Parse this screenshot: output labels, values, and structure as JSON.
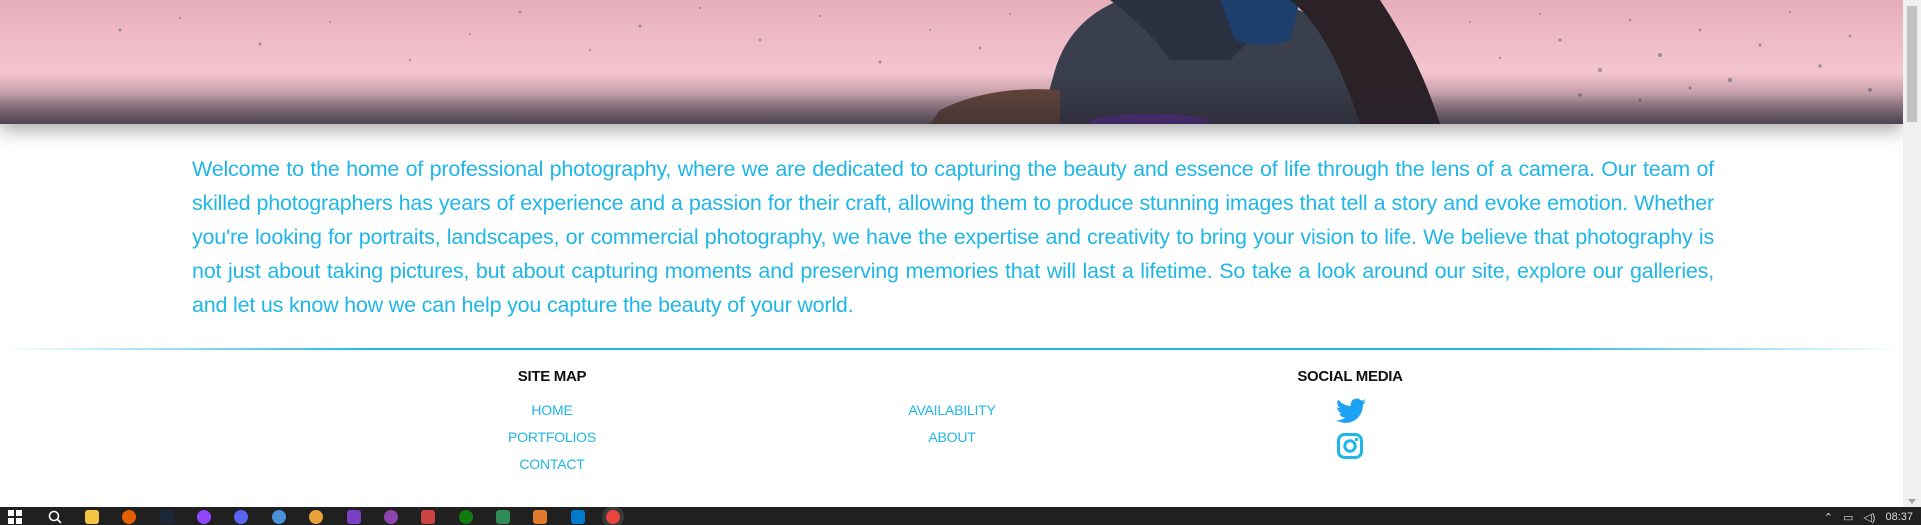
{
  "welcome_text": "Welcome to the home of professional photography, where we are dedicated to capturing the beauty and essence of life through the lens of a camera. Our team of skilled photographers has years of experience and a passion for their craft, allowing them to produce stunning images that tell a story and evoke emotion. Whether you're looking for portraits, landscapes, or commercial photography, we have the expertise and creativity to bring your vision to life. We believe that photography is not just about taking pictures, but about capturing moments and preserving memories that will last a lifetime. So take a look around our site, explore our galleries, and let us know how we can help you capture the beauty of your world.",
  "footer": {
    "site_map_title": "SITE MAP",
    "links": {
      "home": "HOME",
      "portfolios": "PORTFOLIOS",
      "contact": "CONTACT",
      "availability": "AVAILABILITY",
      "about": "ABOUT"
    },
    "social_title": "SOCIAL MEDIA",
    "social_icons": [
      "twitter-icon",
      "instagram-icon"
    ]
  },
  "taskbar": {
    "clock": "08:37"
  },
  "colors": {
    "accent": "#1fb6e8",
    "twitter": "#1da1f2",
    "instagram": "#1fb6e8",
    "hero_pink": "#f2c4ce"
  }
}
